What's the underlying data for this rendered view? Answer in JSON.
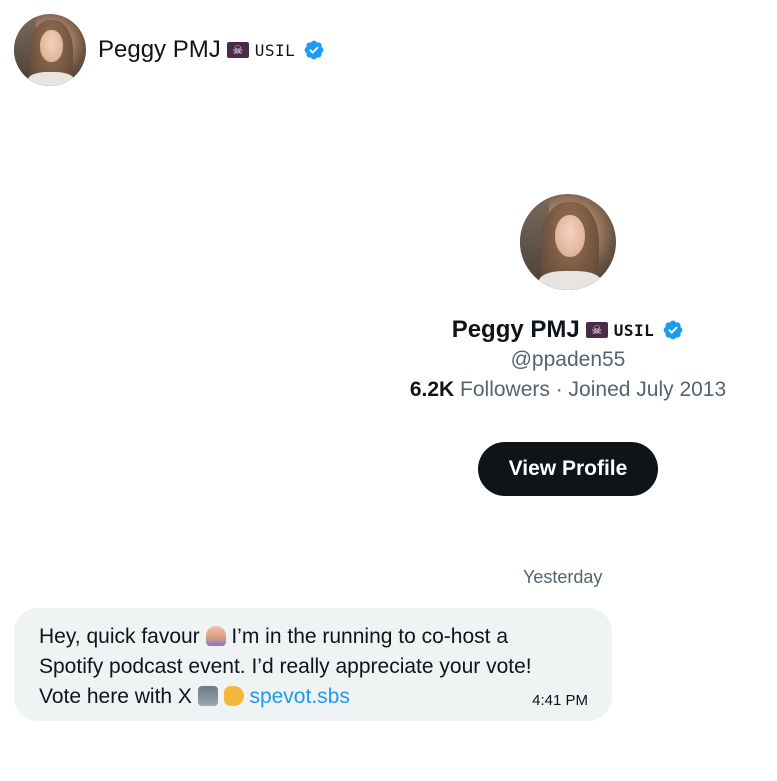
{
  "header": {
    "name": "Peggy PMJ",
    "flag_emoji": "☠",
    "affiliate_text": "USIL",
    "verified_icon": "verified-badge-icon",
    "avatar_icon": "avatar"
  },
  "profile": {
    "name": "Peggy PMJ",
    "flag_emoji": "☠",
    "affiliate_text": "USIL",
    "handle": "@ppaden55",
    "followers_count": "6.2K",
    "followers_suffix": "Followers · Joined July 2013",
    "button_label": "View Profile"
  },
  "date_separator": "Yesterday",
  "message": {
    "line1_a": "Hey, quick favour ",
    "line1_b": " I’m in the running to co-host a",
    "line2": "Spotify podcast event. I’d really appreciate your vote!",
    "line3_a": "Vote here with X ",
    "link": "spevot.sbs",
    "time": "4:41 PM"
  },
  "colors": {
    "accent": "#1d9bf0",
    "text": "#0f1419",
    "muted": "#536471",
    "bubble": "#eff3f4",
    "button": "#0f1419"
  }
}
